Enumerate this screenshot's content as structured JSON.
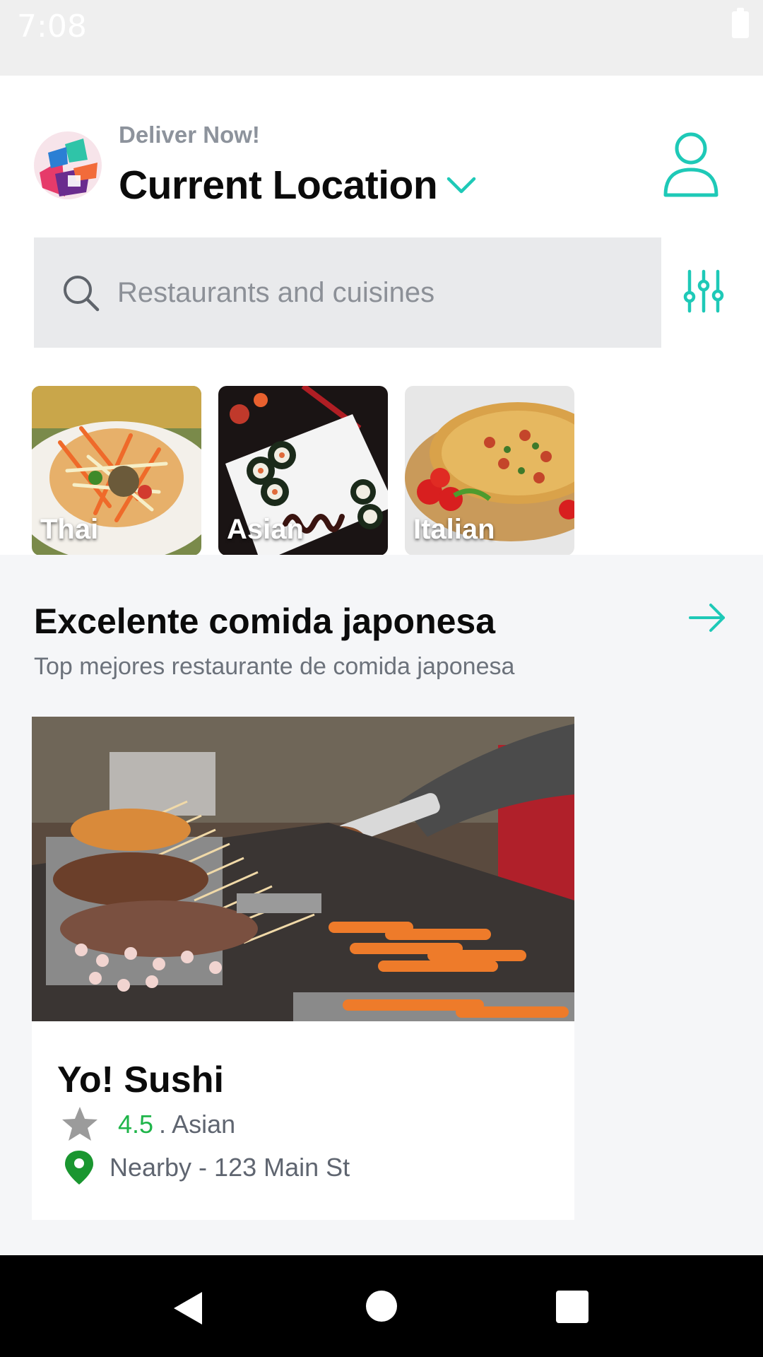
{
  "status_bar": {
    "time": "7:08"
  },
  "header": {
    "deliver_label": "Deliver Now!",
    "location_title": "Current Location"
  },
  "search": {
    "placeholder": "Restaurants and cuisines"
  },
  "categories": [
    {
      "label": "Thai"
    },
    {
      "label": "Asian"
    },
    {
      "label": "Italian"
    }
  ],
  "section": {
    "title": "Excelente comida japonesa",
    "subtitle": "Top mejores restaurante de comida japonesa"
  },
  "restaurant": {
    "name": "Yo! Sushi",
    "rating": "4.5",
    "cuisine": ". Asian",
    "address": "Nearby - 123 Main St"
  },
  "colors": {
    "accent": "#1ec9b7",
    "rating_green": "#1fb54a",
    "pin_green": "#1a9630",
    "search_bg": "#e9eaec",
    "section_bg": "#f5f6f8"
  },
  "icons": {
    "dropdown": "chevron-down-icon",
    "profile": "user-icon",
    "search": "search-icon",
    "filter": "sliders-icon",
    "more": "arrow-right-icon",
    "rating": "star-icon",
    "location": "map-pin-icon"
  }
}
